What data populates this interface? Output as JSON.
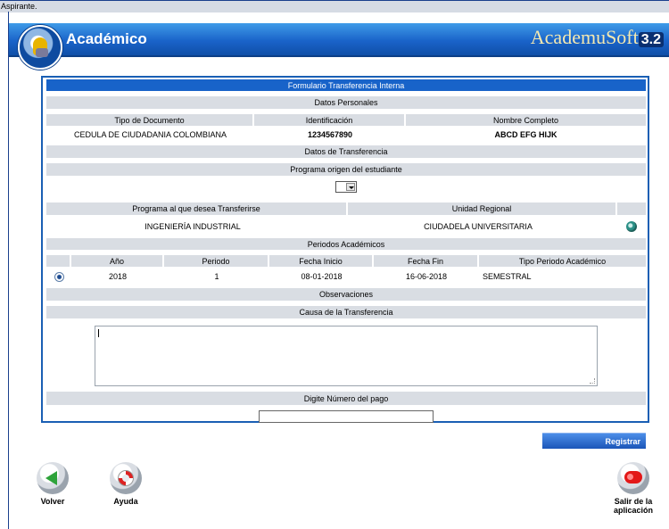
{
  "status_text": "Aspirante.",
  "header": {
    "title": "Académico",
    "brand": "AcademuSoft",
    "version": "3.2"
  },
  "form": {
    "title": "Formulario Transferencia Interna",
    "personal": {
      "section": "Datos Personales",
      "headers": [
        "Tipo de Documento",
        "Identificación",
        "Nombre Completo"
      ],
      "values": [
        "CEDULA DE CIUDADANIA COLOMBIANA",
        "1234567890",
        "ABCD EFG HIJK"
      ]
    },
    "transfer": {
      "section": "Datos de Transferencia",
      "origin_label": "Programa origen del estudiante",
      "origin_value": "",
      "headers": [
        "Programa al que desea Transferirse",
        "Unidad Regional"
      ],
      "values": [
        "INGENIERÍA INDUSTRIAL",
        "CIUDADELA UNIVERSITARIA"
      ]
    },
    "periods": {
      "section": "Periodos Académicos",
      "headers": [
        "Año",
        "Periodo",
        "Fecha Inicio",
        "Fecha Fin",
        "Tipo Periodo Académico"
      ],
      "rows": [
        {
          "year": "2018",
          "period": "1",
          "start": "08-01-2018",
          "end": "16-06-2018",
          "type": "SEMESTRAL"
        }
      ]
    },
    "observations": {
      "section": "Observaciones",
      "cause_label": "Causa de la Transferencia",
      "cause_value": ""
    },
    "payment": {
      "label": "Digite Número del pago",
      "value": ""
    }
  },
  "actions": {
    "register": "Registrar"
  },
  "nav": {
    "back": "Volver",
    "help": "Ayuda",
    "exit_line1": "Salir de la",
    "exit_line2": "aplicación"
  }
}
